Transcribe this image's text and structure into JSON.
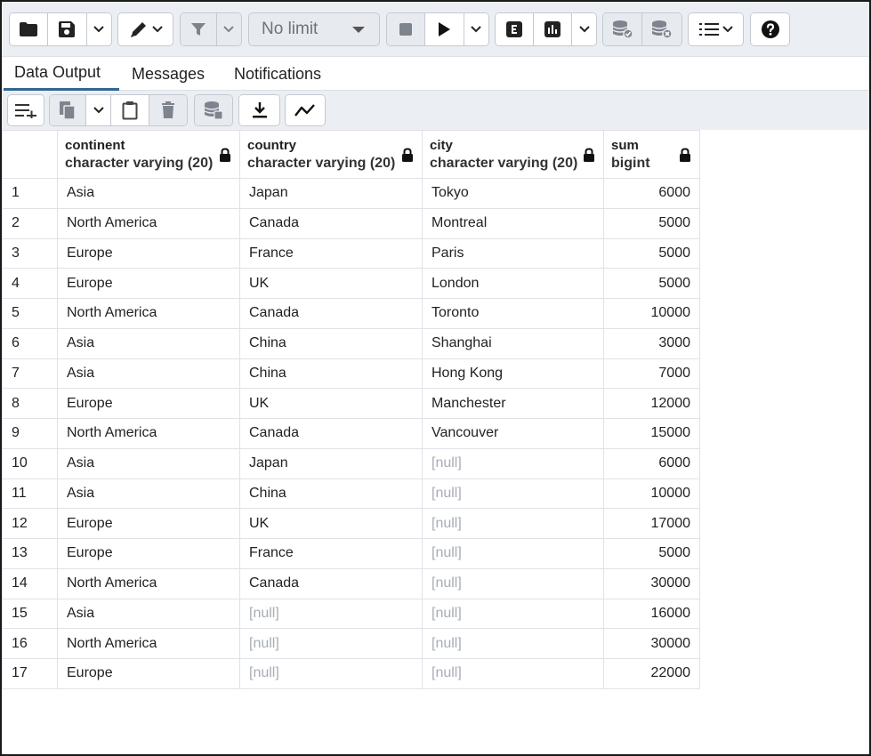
{
  "toolbar": {
    "limit_label": "No limit",
    "icons": [
      "folder-icon",
      "save-icon",
      "edit-pen-icon",
      "filter-icon",
      "stop-icon",
      "play-icon",
      "explain-icon",
      "explain-analyze-icon",
      "commit-icon",
      "rollback-icon",
      "macros-icon",
      "help-icon"
    ]
  },
  "tabs": [
    {
      "label": "Data Output",
      "active": true
    },
    {
      "label": "Messages",
      "active": false
    },
    {
      "label": "Notifications",
      "active": false
    }
  ],
  "columns": [
    {
      "name": "continent",
      "type": "character varying (20)"
    },
    {
      "name": "country",
      "type": "character varying (20)"
    },
    {
      "name": "city",
      "type": "character varying (20)"
    },
    {
      "name": "sum",
      "type": "bigint"
    }
  ],
  "null_label": "[null]",
  "rows": [
    {
      "n": "1",
      "continent": "Asia",
      "country": "Japan",
      "city": "Tokyo",
      "sum": "6000"
    },
    {
      "n": "2",
      "continent": "North America",
      "country": "Canada",
      "city": "Montreal",
      "sum": "5000"
    },
    {
      "n": "3",
      "continent": "Europe",
      "country": "France",
      "city": "Paris",
      "sum": "5000"
    },
    {
      "n": "4",
      "continent": "Europe",
      "country": "UK",
      "city": "London",
      "sum": "5000"
    },
    {
      "n": "5",
      "continent": "North America",
      "country": "Canada",
      "city": "Toronto",
      "sum": "10000"
    },
    {
      "n": "6",
      "continent": "Asia",
      "country": "China",
      "city": "Shanghai",
      "sum": "3000"
    },
    {
      "n": "7",
      "continent": "Asia",
      "country": "China",
      "city": "Hong Kong",
      "sum": "7000"
    },
    {
      "n": "8",
      "continent": "Europe",
      "country": "UK",
      "city": "Manchester",
      "sum": "12000"
    },
    {
      "n": "9",
      "continent": "North America",
      "country": "Canada",
      "city": "Vancouver",
      "sum": "15000"
    },
    {
      "n": "10",
      "continent": "Asia",
      "country": "Japan",
      "city": null,
      "sum": "6000"
    },
    {
      "n": "11",
      "continent": "Asia",
      "country": "China",
      "city": null,
      "sum": "10000"
    },
    {
      "n": "12",
      "continent": "Europe",
      "country": "UK",
      "city": null,
      "sum": "17000"
    },
    {
      "n": "13",
      "continent": "Europe",
      "country": "France",
      "city": null,
      "sum": "5000"
    },
    {
      "n": "14",
      "continent": "North America",
      "country": "Canada",
      "city": null,
      "sum": "30000"
    },
    {
      "n": "15",
      "continent": "Asia",
      "country": null,
      "city": null,
      "sum": "16000"
    },
    {
      "n": "16",
      "continent": "North America",
      "country": null,
      "city": null,
      "sum": "30000"
    },
    {
      "n": "17",
      "continent": "Europe",
      "country": null,
      "city": null,
      "sum": "22000"
    }
  ]
}
